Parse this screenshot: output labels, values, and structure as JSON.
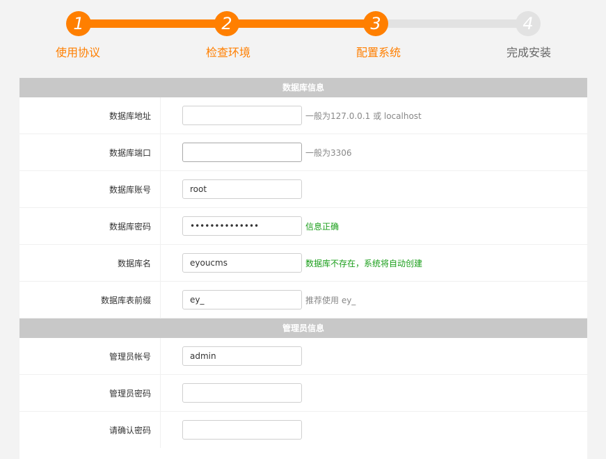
{
  "steps": [
    {
      "number": "1",
      "label": "使用协议"
    },
    {
      "number": "2",
      "label": "检查环境"
    },
    {
      "number": "3",
      "label": "配置系统"
    },
    {
      "number": "4",
      "label": "完成安装"
    }
  ],
  "colors": {
    "accent": "#ff7f00",
    "inactive": "#e2e2e2",
    "header_bg": "#c8c8c8",
    "success": "#1a9e1a"
  },
  "db_section": {
    "title": "数据库信息",
    "rows": [
      {
        "label": "数据库地址",
        "value": "",
        "hint": "一般为127.0.0.1 或 localhost"
      },
      {
        "label": "数据库端口",
        "value": "",
        "hint": "一般为3306"
      },
      {
        "label": "数据库账号",
        "value": "root",
        "hint": ""
      },
      {
        "label": "数据库密码",
        "value": "••••••••••••••",
        "hint": "信息正确"
      },
      {
        "label": "数据库名",
        "value": "eyoucms",
        "hint": "数据库不存在，系统将自动创建"
      },
      {
        "label": "数据库表前缀",
        "value": "ey_",
        "hint": "推荐使用 ey_"
      }
    ]
  },
  "admin_section": {
    "title": "管理员信息",
    "rows": [
      {
        "label": "管理员帐号",
        "value": "admin"
      },
      {
        "label": "管理员密码",
        "value": ""
      },
      {
        "label": "请确认密码",
        "value": ""
      }
    ]
  }
}
